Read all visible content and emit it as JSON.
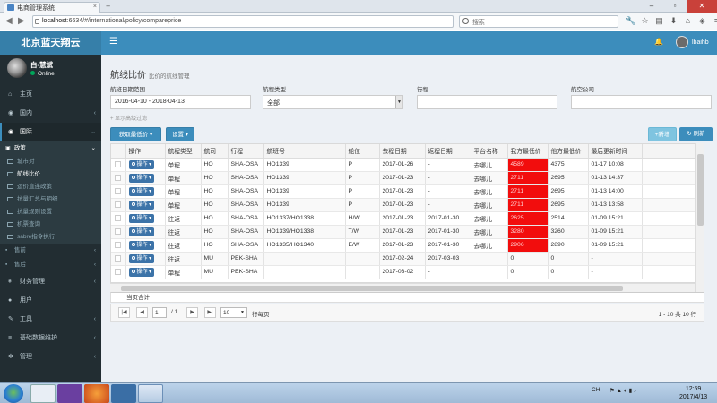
{
  "browser": {
    "tab_title": "电商管理系统",
    "tab_close": "×",
    "new_tab": "+",
    "url_domain": "localhost",
    "url_rest": ":6634/#/international/policy/compareprice",
    "search_placeholder": "搜索"
  },
  "app": {
    "brand": "北京蓝天翔云",
    "user_name": "lbaihb"
  },
  "sidebar": {
    "user": {
      "name": "白-慧斌",
      "status": "Online"
    },
    "items": [
      {
        "label": "主页",
        "icon": "home-icon"
      },
      {
        "label": "国内",
        "icon": "globe-icon"
      },
      {
        "label": "国际",
        "icon": "globe-icon"
      },
      {
        "label": "政策",
        "icon": "list-icon"
      }
    ],
    "sub_items": [
      {
        "label": "城市对"
      },
      {
        "label": "航线比价"
      },
      {
        "label": "运价直连政策"
      },
      {
        "label": "抗量汇总与明细"
      },
      {
        "label": "抗量规则设置"
      },
      {
        "label": "机票查询"
      },
      {
        "label": "sabre指令执行"
      }
    ],
    "items2": [
      {
        "label": "售前"
      },
      {
        "label": "售后"
      },
      {
        "label": "财务管理"
      },
      {
        "label": "用户"
      },
      {
        "label": "工具"
      },
      {
        "label": "基础数据维护"
      },
      {
        "label": "管理"
      }
    ]
  },
  "page": {
    "title": "航线比价",
    "subtitle": "比价的航线管理"
  },
  "filters": {
    "date_label": "航班日期范围",
    "date_value": "2016-04-10 - 2018-04-13",
    "route_type_label": "航程类型",
    "route_type_value": "全部",
    "route_label": "行程",
    "airline_label": "航空公司",
    "advanced": "+ 显示高级过滤"
  },
  "toolbar": {
    "get_price": "获取最低价 ▾",
    "settings": "设置 ▾",
    "add": "+新增",
    "refresh": "刷新"
  },
  "table": {
    "headers": [
      "操作",
      "航程类型",
      "航司",
      "行程",
      "航班号",
      "舱位",
      "去程日期",
      "返程日期",
      "平台名称",
      "我方最低价",
      "他方最低价",
      "最后更新时间"
    ],
    "op_label": "操作 ▾",
    "rows": [
      [
        "单程",
        "HO",
        "SHA-OSA",
        "HO1339",
        "P",
        "2017-01-26",
        "-",
        "去哪儿",
        "4589",
        "4375",
        "01-17 10:08"
      ],
      [
        "单程",
        "HO",
        "SHA-OSA",
        "HO1339",
        "P",
        "2017-01-23",
        "-",
        "去哪儿",
        "2711",
        "2695",
        "01-13 14:37"
      ],
      [
        "单程",
        "HO",
        "SHA-OSA",
        "HO1339",
        "P",
        "2017-01-23",
        "-",
        "去哪儿",
        "2711",
        "2695",
        "01-13 14:00"
      ],
      [
        "单程",
        "HO",
        "SHA-OSA",
        "HO1339",
        "P",
        "2017-01-23",
        "-",
        "去哪儿",
        "2711",
        "2695",
        "01-13 13:58"
      ],
      [
        "往返",
        "HO",
        "SHA-OSA",
        "HO1337/HO1338",
        "H/W",
        "2017-01-23",
        "2017-01-30",
        "去哪儿",
        "2625",
        "2514",
        "01-09 15:21"
      ],
      [
        "往返",
        "HO",
        "SHA-OSA",
        "HO1339/HO1338",
        "T/W",
        "2017-01-23",
        "2017-01-30",
        "去哪儿",
        "3280",
        "3260",
        "01-09 15:21"
      ],
      [
        "往返",
        "HO",
        "SHA-OSA",
        "HO1335/HO1340",
        "E/W",
        "2017-01-23",
        "2017-01-30",
        "去哪儿",
        "2906",
        "2890",
        "01-09 15:21"
      ],
      [
        "往返",
        "MU",
        "PEK-SHA",
        "",
        "",
        "2017-02-24",
        "2017-03-03",
        "",
        "0",
        "0",
        "-"
      ],
      [
        "单程",
        "MU",
        "PEK-SHA",
        "",
        "",
        "2017-03-02",
        "-",
        "",
        "0",
        "0",
        "-"
      ]
    ],
    "red_rows": 7,
    "total_label": "当页合计"
  },
  "pager": {
    "page": "1",
    "of": "/ 1",
    "page_size": "10",
    "page_size_suffix": "行每页",
    "summary": "1 - 10 共 10 行"
  },
  "taskbar": {
    "time": "12:59",
    "date": "2017/4/13",
    "lang": "CH"
  }
}
